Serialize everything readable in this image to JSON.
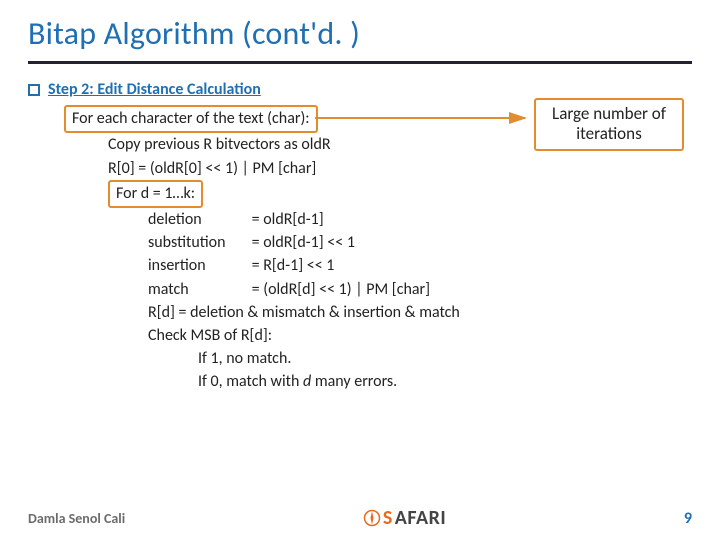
{
  "title": "Bitap Algorithm (cont'd. )",
  "step": {
    "label": "Step 2: Edit Distance Calculation"
  },
  "callout": {
    "line1": "Large number of",
    "line2": "iterations"
  },
  "code": {
    "for_text": "For each character of the text (char):",
    "copy_prev": "Copy previous R bitvectors as oldR",
    "r0": "R[0] = (oldR[0] << 1) | PM [char]",
    "for_d": "For d = 1…k:",
    "del_label": "deletion",
    "del_rhs": "= oldR[d-1]",
    "sub_label": "substitution",
    "sub_rhs": "= oldR[d-1] << 1",
    "ins_label": "insertion",
    "ins_rhs": "= R[d-1] << 1",
    "match_label": "match",
    "match_rhs": "= (oldR[d] << 1) | PM [char]",
    "rd_assign": "R[d] = deletion & mismatch & insertion & match",
    "check_msb": "Check MSB of R[d]:",
    "if1": "If 1, no match.",
    "if0_a": "If 0, match with ",
    "if0_d": "d",
    "if0_b": " many errors."
  },
  "footer": {
    "author": "Damla Senol Cali",
    "logo": "SAFARI",
    "page": "9"
  }
}
